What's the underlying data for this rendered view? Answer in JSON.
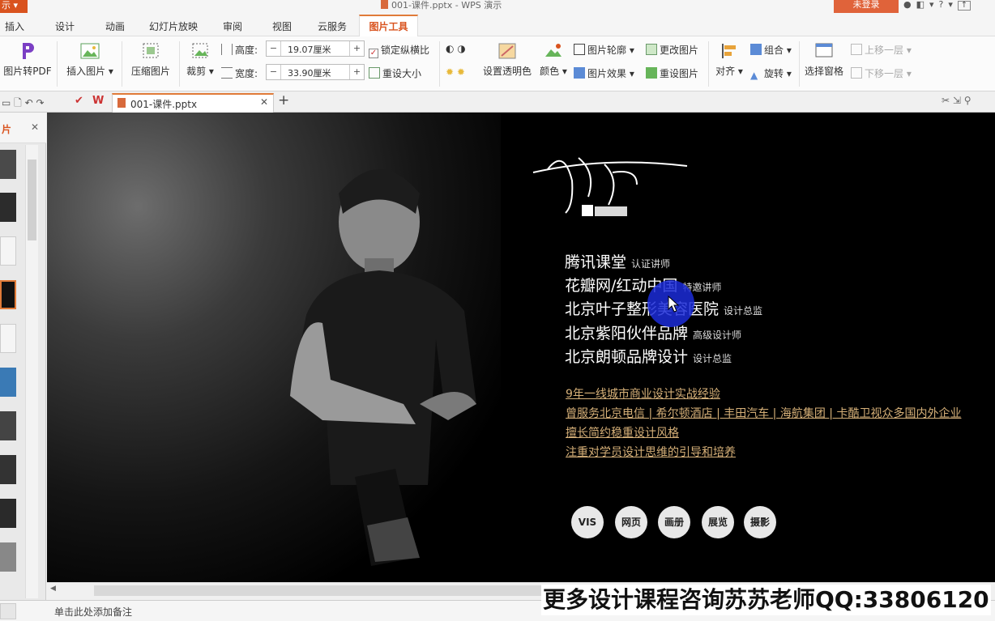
{
  "titlebar": {
    "app_button": "示",
    "doc_title": "001-课件.pptx - WPS 演示",
    "login": "未登录",
    "icons": [
      "feedback-icon",
      "skin-icon",
      "help-icon",
      "minimize-icon"
    ]
  },
  "menu": {
    "tabs": [
      "插入",
      "设计",
      "动画",
      "幻灯片放映",
      "审阅",
      "视图",
      "云服务"
    ],
    "active_tab": "图片工具"
  },
  "ribbon": {
    "to_pdf": "图片转PDF",
    "insert_picture": "插入图片",
    "compress": "压缩图片",
    "crop": "裁剪",
    "height_label": "高度:",
    "height_value": "19.07厘米",
    "width_label": "宽度:",
    "width_value": "33.90厘米",
    "lock_ratio": "锁定纵横比",
    "reset_size": "重设大小",
    "set_transparent": "设置透明色",
    "color": "颜色",
    "outline": "图片轮廓",
    "effects": "图片效果",
    "change_picture": "更改图片",
    "reset_picture": "重设图片",
    "align": "对齐",
    "group": "组合",
    "rotate": "旋转",
    "selection_pane": "选择窗格",
    "bring_forward": "上移一层",
    "send_backward": "下移一层"
  },
  "tabstrip": {
    "doc_tab": "001-课件.pptx"
  },
  "leftpanel": {
    "header": "片"
  },
  "slide": {
    "roles": [
      {
        "org": "腾讯课堂",
        "role": "认证讲师"
      },
      {
        "org": "花瓣网/红动中国",
        "role": "特邀讲师"
      },
      {
        "org": "北京叶子整形美容医院",
        "role": "设计总监"
      },
      {
        "org": "北京紫阳伙伴品牌",
        "role": "高级设计师"
      },
      {
        "org": "北京朗顿品牌设计",
        "role": "设计总监"
      }
    ],
    "highlights": [
      "9年一线城市商业设计实战经验",
      "曾服务北京电信 | 希尔顿酒店 | 丰田汽车 | 海航集团 | 卡酷卫视众多国内外企业",
      "擅长简约稳重设计风格",
      "注重对学员设计思维的引导和培养"
    ],
    "pills": [
      "VIS",
      "网页",
      "画册",
      "展览",
      "摄影"
    ]
  },
  "statusbar": {
    "notes_placeholder": "单击此处添加备注"
  },
  "watermark": "更多设计课程咨询苏苏老师QQ:33806120"
}
